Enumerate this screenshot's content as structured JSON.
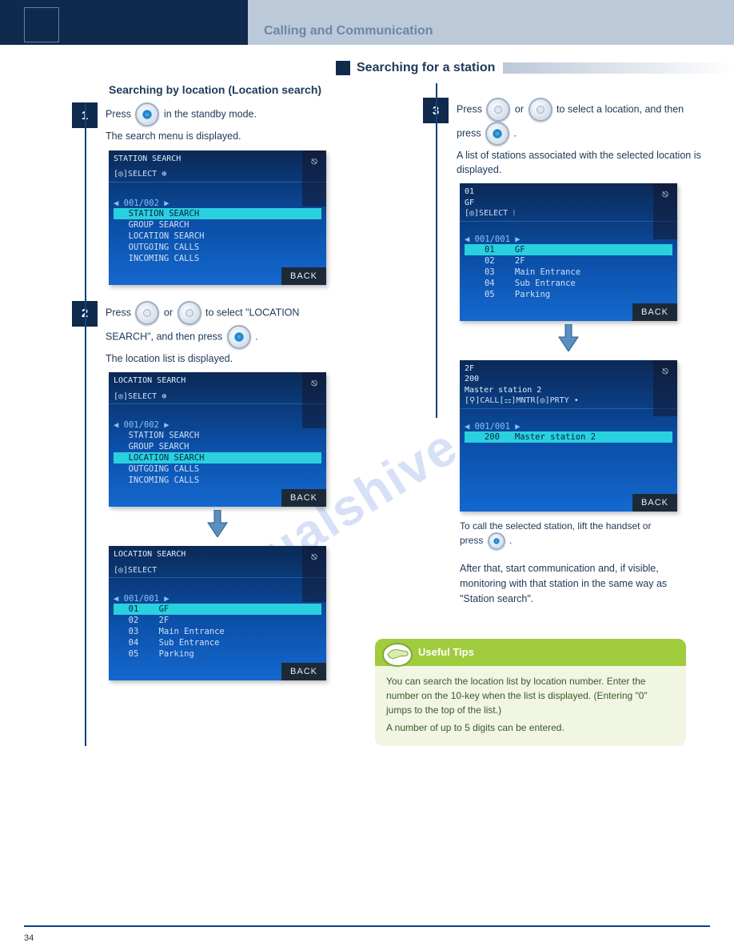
{
  "header": {
    "title": "Calling and Communication"
  },
  "subheader": {
    "label": "Searching for a station"
  },
  "left": {
    "section_title": "Searching by location (Location search)",
    "step1": {
      "num": "1",
      "text_before": "Press",
      "text_after": "in the standby mode.",
      "note": "The search menu is displayed."
    },
    "screen1": {
      "title": "STATION SEARCH",
      "sub": "[◎]SELECT            ⊕",
      "pager": "◀ 001/002 ▶",
      "items": [
        "  STATION SEARCH",
        "  GROUP SEARCH",
        "  LOCATION SEARCH",
        "  OUTGOING CALLS",
        "  INCOMING CALLS"
      ],
      "hl_index": 0,
      "back": "BACK"
    },
    "step2": {
      "num": "2",
      "text_before": "Press",
      "text_mid": " or ",
      "text_after1": " to select \"LOCATION",
      "text_after2": "SEARCH\", and then press ",
      "text_after3": ".",
      "note": "The location list is displayed."
    },
    "screen2": {
      "title": "LOCATION SEARCH",
      "sub": "[◎]SELECT            ⊕",
      "pager": "◀ 001/002 ▶",
      "items": [
        "  STATION SEARCH",
        "  GROUP SEARCH",
        "  LOCATION SEARCH",
        "  OUTGOING CALLS",
        "  INCOMING CALLS"
      ],
      "hl_index": 2,
      "back": "BACK"
    },
    "screen3": {
      "title": "LOCATION SEARCH",
      "sub": "[◎]SELECT",
      "pager": "◀ 001/001 ▶",
      "items": [
        "  01    GF",
        "  02    2F",
        "  03    Main Entrance",
        "  04    Sub Entrance",
        "  05    Parking"
      ],
      "hl_index": 0,
      "back": "BACK"
    }
  },
  "right": {
    "step3": {
      "num": "3",
      "text_before": "Press ",
      "text_mid": " or ",
      "text_after1": " to select a location, and then",
      "text_after2": "press ",
      "text_after3": ".",
      "note": "A list of stations associated with the selected location is displayed."
    },
    "screen4": {
      "title1": "01",
      "title2": "GF",
      "sub": "[◎]SELECT                ⁝",
      "pager": "◀ 001/001 ▶",
      "items": [
        "   01    GF",
        "   02    2F",
        "   03    Main Entrance",
        "   04    Sub Entrance",
        "   05    Parking"
      ],
      "hl_index": 0,
      "back": "BACK"
    },
    "screen5": {
      "title1": "2F",
      "title2": "200",
      "title3": "Master station 2",
      "sub": "[⚲]CALL[⚏]MNTR[◎]PRTY   •",
      "pager": "◀ 001/001 ▶",
      "items": [
        "   200   Master station 2"
      ],
      "hl_index": 0,
      "back": "BACK"
    },
    "call_instruction1": "To call the selected station, lift the handset or",
    "call_instruction2": "press ",
    "call_instruction3": ".",
    "after": "After that, start communication and, if visible, monitoring with that station in the same way as \"Station search\"."
  },
  "tip": {
    "head": "Useful Tips",
    "body1": "You can search the location list by location number. Enter the number on the 10-key when the list is displayed. (Entering \"0\" jumps to the top of the list.)",
    "body2": "A number of up to 5 digits can be entered."
  },
  "page": "34",
  "watermark": "manualshive.com"
}
